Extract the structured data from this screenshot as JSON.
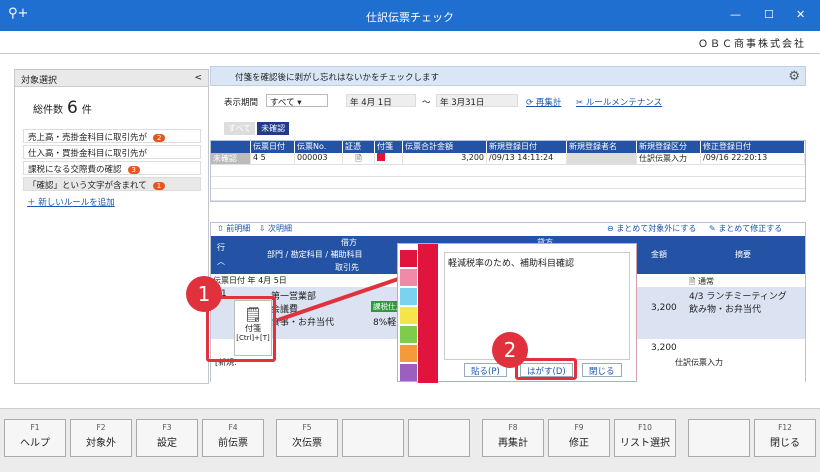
{
  "window": {
    "title": "仕訳伝票チェック",
    "company": "ＯＢＣ商事株式会社",
    "icon": "magnifier-plus-icon"
  },
  "left": {
    "header": "対象選択",
    "total_label": "総件数",
    "total_value": "6",
    "total_unit": "件",
    "rules": [
      {
        "label": "売上高・売掛金科目に取引先が",
        "badge": "2"
      },
      {
        "label": "仕入高・買掛金科目に取引先が",
        "badge": ""
      },
      {
        "label": "課税になる交際費の確認",
        "badge": "3"
      },
      {
        "label": "「確認」という文字が含まれて",
        "badge": "1"
      }
    ],
    "add_rule": "新しいルールを追加"
  },
  "main": {
    "info": "付箋を確認後に剥がし忘れはないかをチェックします",
    "period_label": "表示期間",
    "period_value": "すべて",
    "date_from": "年  4月  1日",
    "tilde": "～",
    "date_to": "年  3月31日",
    "recalc": "再集計",
    "rule_maint": "ルールメンテナンス",
    "tab_all": "すべて",
    "tab_unconfirmed": "未確認",
    "tab_badge": "1",
    "columns": [
      "",
      "伝票日付",
      "伝票No.",
      "証憑",
      "付箋",
      "伝票合計金額",
      "新規登録日付",
      "新規登録者名",
      "新規登録区分",
      "修正登録日付"
    ],
    "row": [
      "未確認",
      "4 5",
      "000003",
      "",
      "",
      "3,200",
      "/09/13 14:11:24",
      "",
      "仕訳伝票入力",
      "/09/16 22:20:13"
    ]
  },
  "lower": {
    "prev": "前明細",
    "next": "次明細",
    "exclude_all": "まとめて対象外にする",
    "fix_all": "まとめて修正する",
    "h_row": "行",
    "h_debit": "借方",
    "h_dept": "部門 / 勘定科目 / 補助科目",
    "h_partner": "取引先",
    "h_credit": "貸方",
    "h_amount": "金額",
    "h_summary": "摘要",
    "date": "伝票日付     年  4月  5日",
    "line_no": "1",
    "dept": "第一営業部",
    "account": "会議費",
    "sub": "食事・お弁当代",
    "tax_tag": "課税仕入",
    "tax_rate": "8%軽",
    "amount": "3,200",
    "summary": "4/3 ランチミーティング\n飲み物・お弁当代",
    "kind": "通常",
    "total": "3,200",
    "new_label": "[新規:",
    "entry": "仕訳伝票入力"
  },
  "fusen": {
    "label": "付箋",
    "shortcut": "[Ctrl]+[T]"
  },
  "popup": {
    "memo": "軽減税率のため、補助科目確認",
    "paste": "貼る(P)",
    "peel": "はがす(D)",
    "close": "閉じる",
    "colors": [
      "#e0143c",
      "#f08aa8",
      "#7ad3ee",
      "#f7e34a",
      "#7ecc4a",
      "#f59a3a",
      "#9a5fbf"
    ]
  },
  "callouts": [
    "1",
    "2"
  ],
  "fkeys": [
    {
      "k": "F1",
      "l": "ヘルプ"
    },
    {
      "k": "F2",
      "l": "対象外"
    },
    {
      "k": "F3",
      "l": "設定"
    },
    {
      "k": "F4",
      "l": "前伝票"
    },
    {
      "k": "F5",
      "l": "次伝票"
    },
    {
      "k": "",
      "l": ""
    },
    {
      "k": "",
      "l": ""
    },
    {
      "k": "F8",
      "l": "再集計"
    },
    {
      "k": "F9",
      "l": "修正"
    },
    {
      "k": "F10",
      "l": "リスト選択"
    },
    {
      "k": "",
      "l": ""
    },
    {
      "k": "F12",
      "l": "閉じる"
    }
  ]
}
